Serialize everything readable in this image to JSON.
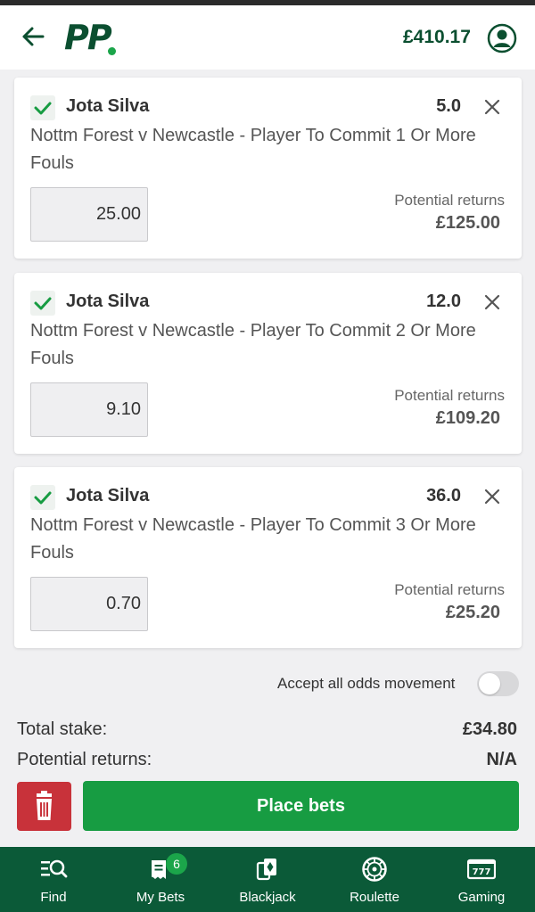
{
  "header": {
    "logo_text": "PP",
    "balance": "£410.17"
  },
  "bets": [
    {
      "selection": "Jota Silva",
      "odds": "5.0",
      "market": "Nottm Forest v Newcastle - Player To Commit 1 Or More Fouls",
      "stake": "25.00",
      "potential_label": "Potential returns",
      "potential_value": "£125.00"
    },
    {
      "selection": "Jota Silva",
      "odds": "12.0",
      "market": "Nottm Forest v Newcastle - Player To Commit 2 Or More Fouls",
      "stake": "9.10",
      "potential_label": "Potential returns",
      "potential_value": "£109.20"
    },
    {
      "selection": "Jota Silva",
      "odds": "36.0",
      "market": "Nottm Forest v Newcastle - Player To Commit 3 Or More Fouls",
      "stake": "0.70",
      "potential_label": "Potential returns",
      "potential_value": "£25.20"
    }
  ],
  "accept_odds_label": "Accept all odds movement",
  "summary": {
    "total_stake_label": "Total stake:",
    "total_stake_value": "£34.80",
    "potential_returns_label": "Potential returns:",
    "potential_returns_value": "N/A"
  },
  "actions": {
    "place_bets_label": "Place bets"
  },
  "nav": [
    {
      "label": "Find",
      "icon": "find-icon"
    },
    {
      "label": "My Bets",
      "icon": "my-bets-icon",
      "badge": "6"
    },
    {
      "label": "Blackjack",
      "icon": "blackjack-icon"
    },
    {
      "label": "Roulette",
      "icon": "roulette-icon"
    },
    {
      "label": "Gaming",
      "icon": "slots-icon"
    }
  ],
  "colors": {
    "brand_green": "#0b4f30",
    "accent_green": "#179c42",
    "nav_background": "#0b5a38",
    "delete_red": "#c8323a"
  }
}
